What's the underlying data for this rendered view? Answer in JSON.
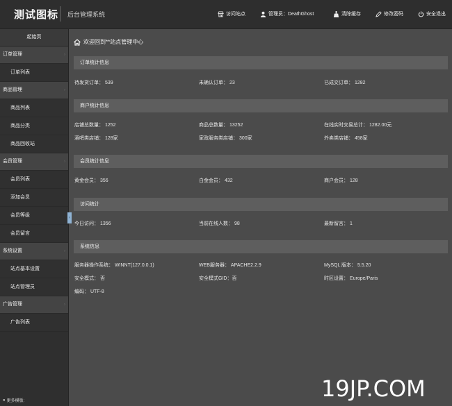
{
  "header": {
    "logo": "测试图标",
    "system_name": "后台管理系统",
    "nav": [
      {
        "label": "访问站点",
        "icon": "home-store-icon"
      },
      {
        "label": "管理员：DeathGhost",
        "icon": "user-icon"
      },
      {
        "label": "清除缓存",
        "icon": "broom-icon"
      },
      {
        "label": "修改密码",
        "icon": "pen-icon"
      },
      {
        "label": "安全退出",
        "icon": "power-icon"
      }
    ]
  },
  "sidebar": {
    "home": "起始页",
    "groups": [
      {
        "label": "订单管理",
        "items": [
          "订单列表"
        ]
      },
      {
        "label": "商品管理",
        "items": [
          "商品列表",
          "商品分类",
          "商品回收站"
        ]
      },
      {
        "label": "会员管理",
        "items": [
          "会员列表",
          "添加会员",
          "会员等级",
          "会员留言"
        ]
      },
      {
        "label": "系统设置",
        "items": [
          "站点基本设置",
          "站点管理员"
        ]
      },
      {
        "label": "广告管理",
        "items": [
          "广告列表"
        ]
      }
    ],
    "footer": "更多模板:"
  },
  "main": {
    "welcome": "欢迎回到**站点管理中心",
    "sections": [
      {
        "title": "订单统计信息",
        "rows": [
          [
            "待发货订单： 539",
            "未确认订单： 23",
            "已成交订单： 1282"
          ]
        ]
      },
      {
        "title": "商户统计信息",
        "rows": [
          [
            "店铺总数量： 1252",
            "商品总数量： 13252",
            "在线实时交易总计： 1282.00元"
          ],
          [
            "酒吧类店铺： 128家",
            "家政服务类店铺： 300家",
            "外卖类店铺： 458家"
          ]
        ]
      },
      {
        "title": "会员统计信息",
        "rows": [
          [
            "黄金会员： 356",
            "白金会员： 432",
            "商户会员： 128"
          ]
        ]
      },
      {
        "title": "访问统计",
        "rows": [
          [
            "今日访问： 1356",
            "当前在线人数： 98",
            "最新留言： 1"
          ]
        ]
      },
      {
        "title": "系统信息",
        "rows": [
          [
            "服务器操作系统： WINNT(127.0.0.1)",
            "WEB服务器： APACHE2.2.9",
            "MySQL 版本： 5.5.20"
          ],
          [
            "安全模式： 否",
            "安全模式GID：否",
            "时区设置： Europe/Paris"
          ],
          [
            "编码： UTF-8",
            "",
            ""
          ]
        ]
      }
    ]
  },
  "watermark": "19JP.COM"
}
